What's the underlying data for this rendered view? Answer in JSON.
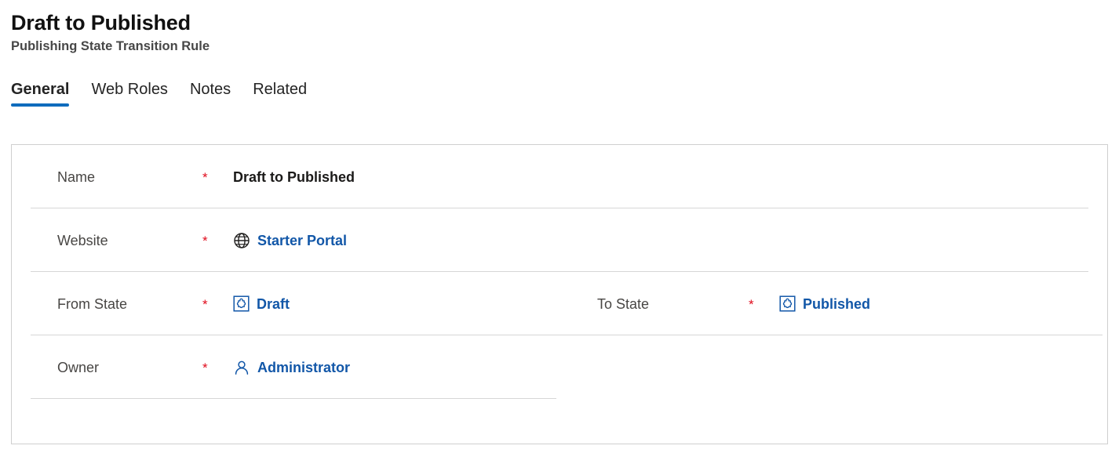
{
  "header": {
    "title": "Draft to Published",
    "subtitle": "Publishing State Transition Rule"
  },
  "tabs": [
    {
      "label": "General",
      "selected": true
    },
    {
      "label": "Web Roles",
      "selected": false
    },
    {
      "label": "Notes",
      "selected": false
    },
    {
      "label": "Related",
      "selected": false
    }
  ],
  "form": {
    "required_marker": "*",
    "fields": {
      "name": {
        "label": "Name",
        "value": "Draft to Published",
        "required": true,
        "icon": null
      },
      "website": {
        "label": "Website",
        "value": "Starter Portal",
        "required": true,
        "icon": "globe-icon"
      },
      "from_state": {
        "label": "From State",
        "value": "Draft",
        "required": true,
        "icon": "entity-record-icon"
      },
      "to_state": {
        "label": "To State",
        "value": "Published",
        "required": true,
        "icon": "entity-record-icon"
      },
      "owner": {
        "label": "Owner",
        "value": "Administrator",
        "required": true,
        "icon": "person-icon"
      }
    }
  },
  "colors": {
    "accent_blue": "#0f6cbd",
    "link_blue": "#1257a8",
    "required_red": "#e00b1c",
    "label_gray": "#484644",
    "border_gray": "#cfcfcf",
    "divider_gray": "#d6d6d6"
  }
}
